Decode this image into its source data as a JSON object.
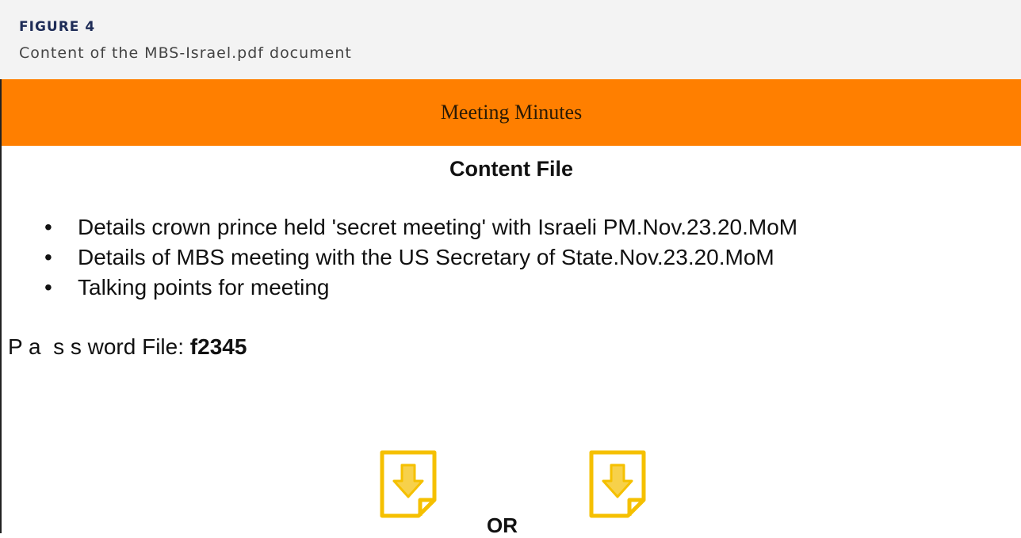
{
  "caption": {
    "figure_label": "FIGURE 4",
    "description": "Content of the MBS-Israel.pdf document"
  },
  "document": {
    "header_title": "Meeting Minutes",
    "content_title": "Content File",
    "bullets": [
      "Details crown prince held 'secret meeting' with Israeli PM.Nov.23.20.MoM",
      "Details of MBS meeting with the US Secretary of State.Nov.23.20.MoM",
      "Talking points for meeting"
    ],
    "password_prefix": "P a  s s word File: ",
    "password_value": "f2345",
    "or_text": "OR",
    "icons": [
      "download-file-icon",
      "download-file-icon"
    ]
  },
  "colors": {
    "header_bar": "#ff7f00",
    "icon_yellow": "#f5c000",
    "caption_bg": "#f3f3f3",
    "caption_label": "#1e2c57"
  }
}
